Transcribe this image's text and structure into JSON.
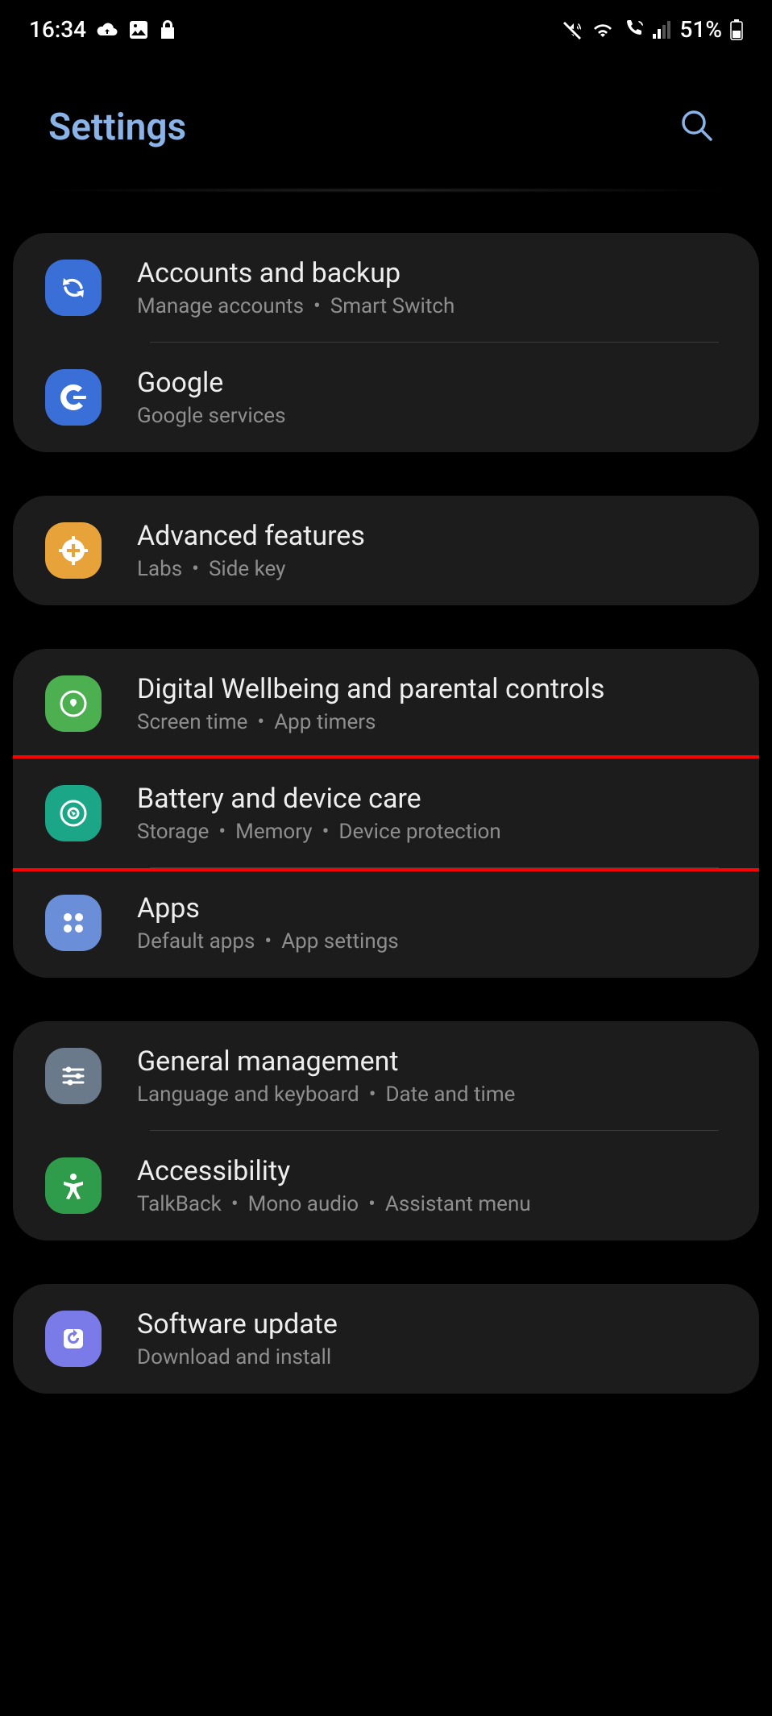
{
  "status": {
    "time": "16:34",
    "battery": "51%"
  },
  "header": {
    "title": "Settings"
  },
  "groups": [
    {
      "items": [
        {
          "id": "accounts",
          "title": "Accounts and backup",
          "subs": [
            "Manage accounts",
            "Smart Switch"
          ],
          "highlight": false
        },
        {
          "id": "google",
          "title": "Google",
          "subs": [
            "Google services"
          ],
          "highlight": false
        }
      ]
    },
    {
      "items": [
        {
          "id": "advanced",
          "title": "Advanced features",
          "subs": [
            "Labs",
            "Side key"
          ],
          "highlight": false
        }
      ]
    },
    {
      "items": [
        {
          "id": "wellbeing",
          "title": "Digital Wellbeing and parental controls",
          "subs": [
            "Screen time",
            "App timers"
          ],
          "highlight": false
        },
        {
          "id": "battery",
          "title": "Battery and device care",
          "subs": [
            "Storage",
            "Memory",
            "Device protection"
          ],
          "highlight": true
        },
        {
          "id": "apps",
          "title": "Apps",
          "subs": [
            "Default apps",
            "App settings"
          ],
          "highlight": false
        }
      ]
    },
    {
      "items": [
        {
          "id": "general",
          "title": "General management",
          "subs": [
            "Language and keyboard",
            "Date and time"
          ],
          "highlight": false
        },
        {
          "id": "accessibility",
          "title": "Accessibility",
          "subs": [
            "TalkBack",
            "Mono audio",
            "Assistant menu"
          ],
          "highlight": false
        }
      ]
    },
    {
      "items": [
        {
          "id": "software",
          "title": "Software update",
          "subs": [
            "Download and install"
          ],
          "highlight": false
        }
      ]
    }
  ]
}
